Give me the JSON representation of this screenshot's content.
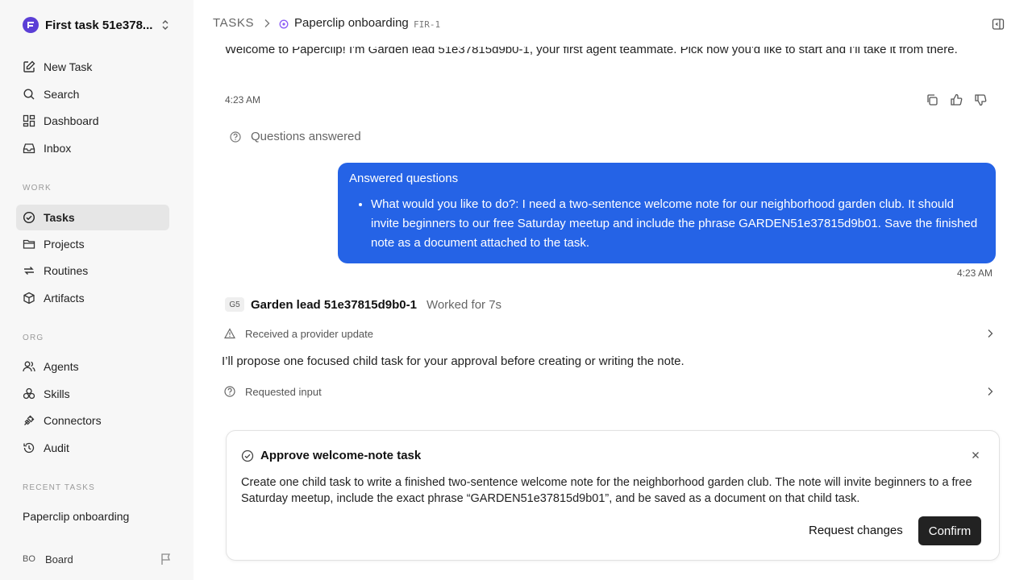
{
  "workspace": {
    "name": "First task 51e378..."
  },
  "nav": {
    "main": [
      {
        "label": "New Task",
        "icon": "new-task-icon"
      },
      {
        "label": "Search",
        "icon": "search-icon"
      },
      {
        "label": "Dashboard",
        "icon": "dashboard-icon"
      },
      {
        "label": "Inbox",
        "icon": "inbox-icon"
      }
    ],
    "work_label": "WORK",
    "work": [
      {
        "label": "Tasks",
        "icon": "tasks-icon",
        "active": true
      },
      {
        "label": "Projects",
        "icon": "folder-icon"
      },
      {
        "label": "Routines",
        "icon": "repeat-icon"
      },
      {
        "label": "Artifacts",
        "icon": "box-icon"
      }
    ],
    "org_label": "ORG",
    "org": [
      {
        "label": "Agents",
        "icon": "users-icon"
      },
      {
        "label": "Skills",
        "icon": "skills-icon"
      },
      {
        "label": "Connectors",
        "icon": "plug-icon"
      },
      {
        "label": "Audit",
        "icon": "history-icon"
      }
    ],
    "recent_label": "RECENT TASKS",
    "recent": [
      "Paperclip onboarding"
    ]
  },
  "user": {
    "initials": "BO",
    "name": "Board"
  },
  "header": {
    "root": "TASKS",
    "title": "Paperclip onboarding",
    "id": "FIR-1"
  },
  "conversation": {
    "welcome": "Welcome to Paperclip! I'm Garden lead 51e37815d9b0-1, your first agent teammate. Pick how you'd like to start and I'll take it from there.",
    "welcome_time": "4:23 AM",
    "questions_answered": "Questions answered",
    "bubble_title": "Answered questions",
    "bubble_item": "What would you like to do?: I need a two-sentence welcome note for our neighborhood garden club. It should invite beginners to our free Saturday meetup and include the phrase GARDEN51e37815d9b01. Save the finished note as a document attached to the task.",
    "bubble_time": "4:23 AM",
    "agent_initials": "G5",
    "agent_name": "Garden lead 51e37815d9b0-1",
    "worked_for": "Worked for 7s",
    "event_update": "Received a provider update",
    "agent_message": "I’ll propose one focused child task for your approval before creating or writing the note.",
    "event_input": "Requested input"
  },
  "approval": {
    "title": "Approve welcome-note task",
    "body": "Create one child task to write a finished two-sentence welcome note for the neighborhood garden club. The note will invite beginners to a free Saturday meetup, include the exact phrase “GARDEN51e37815d9b01”, and be saved as a document on that child task.",
    "request_changes": "Request changes",
    "confirm": "Confirm"
  },
  "colors": {
    "accent": "#2563e6",
    "logo": "#5b3fd6",
    "status": "#8b5cf6",
    "dark_button": "#222222"
  }
}
